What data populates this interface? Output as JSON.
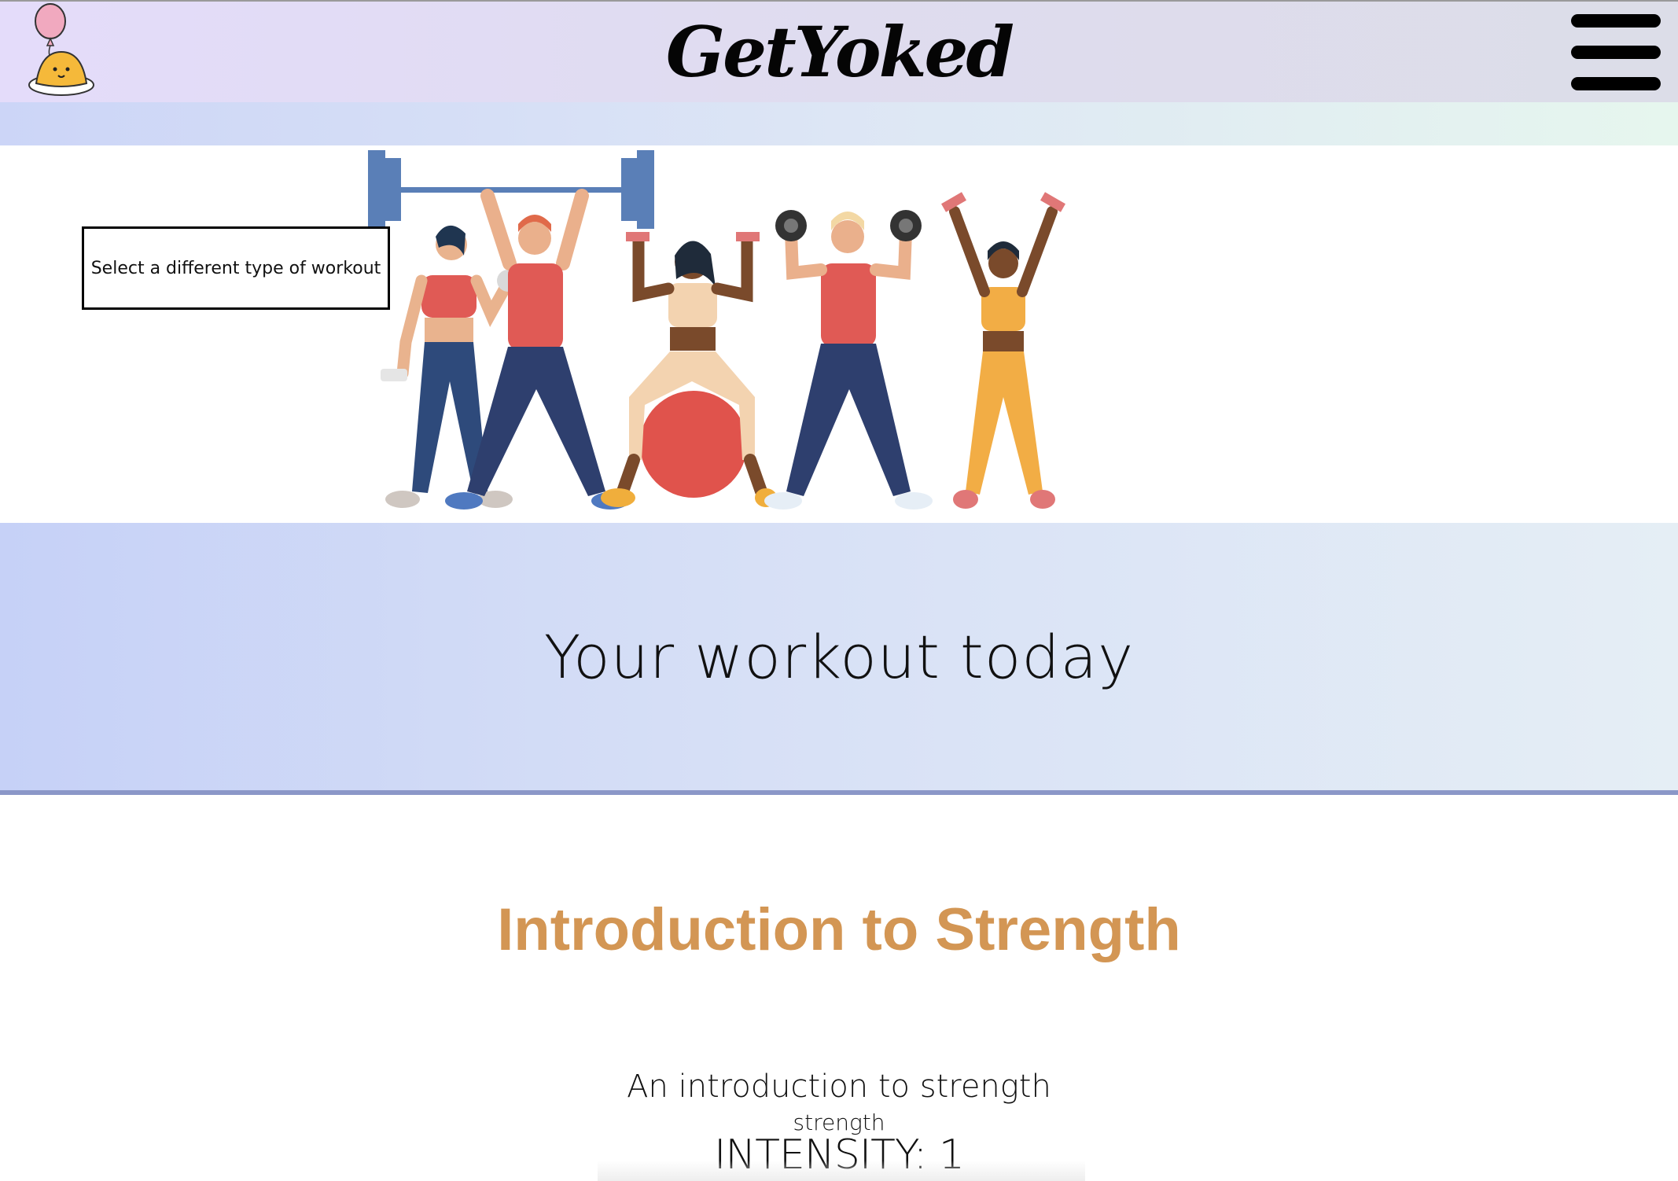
{
  "navbar": {
    "brand": "GetYoked",
    "logo_icon": "egg-balloon-icon",
    "menu_icon": "hamburger-menu-icon"
  },
  "hero": {
    "select_button_label": "Select a different type of workout",
    "illustration": "fitness-people-illustration"
  },
  "banner": {
    "title": "Your workout today"
  },
  "workout": {
    "title": "Introduction to Strength",
    "description": "An introduction to strength",
    "category": "strength",
    "intensity_label": "INTENSITY: 1"
  },
  "colors": {
    "accent_title": "#d39654",
    "navbar_bg": "#e2dcf4",
    "banner_bg": "#d3dcf6",
    "rule": "#8b97c8"
  }
}
